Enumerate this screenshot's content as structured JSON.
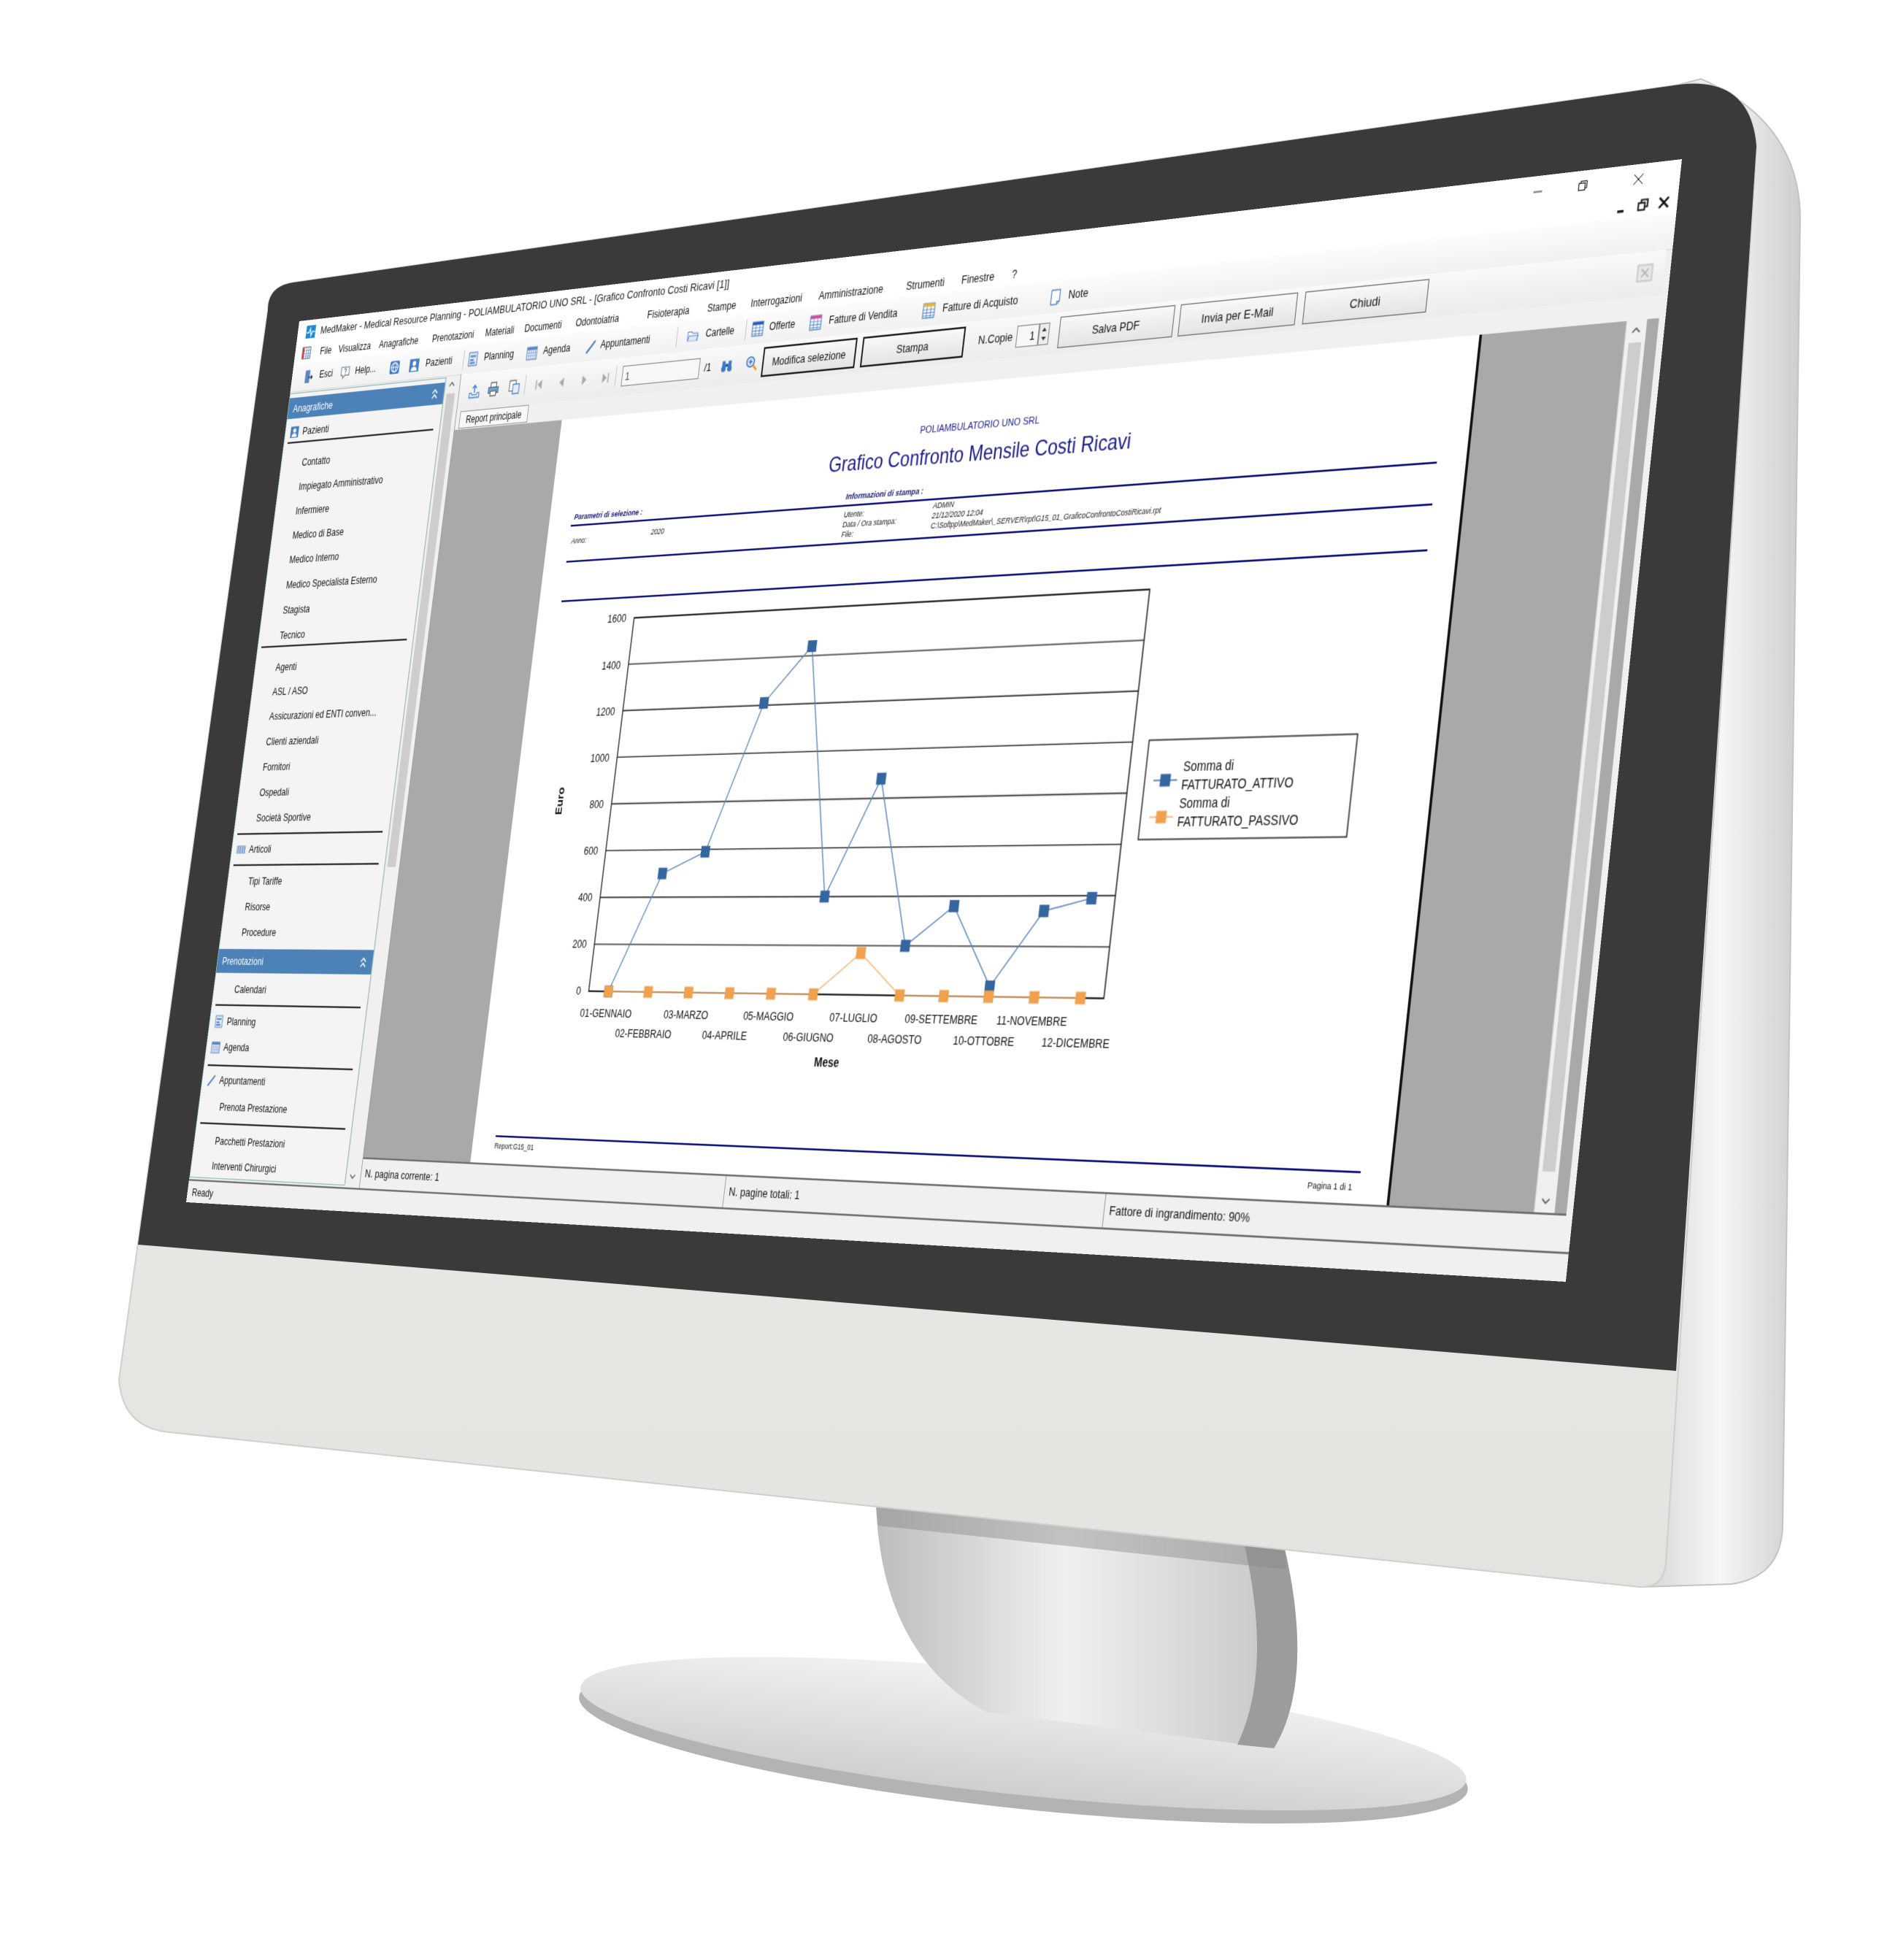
{
  "app": {
    "title": "MedMaker - Medical Resource Planning - POLIAMBULATORIO UNO SRL - [Grafico Confronto Costi Ricavi [1]]",
    "icon": "medmaker-logo-icon"
  },
  "menu": {
    "items": [
      "File",
      "Visualizza",
      "Anagrafiche",
      "Prenotazioni",
      "Materiali",
      "Documenti",
      "Odontoiatria",
      "Fisioterapia",
      "Stampe",
      "Interrogazioni",
      "Amministrazione",
      "Strumenti",
      "Finestre",
      "?"
    ]
  },
  "toolbar": {
    "items": [
      {
        "label": "Esci",
        "icon": "exit-icon"
      },
      {
        "label": "Help...",
        "icon": "help-icon"
      },
      {
        "label": "",
        "icon": "globe-icon"
      },
      {
        "label": "Pazienti",
        "icon": "patient-icon"
      },
      {
        "label": "Planning",
        "icon": "planning-icon"
      },
      {
        "label": "Agenda",
        "icon": "agenda-icon"
      },
      {
        "label": "Appuntamenti",
        "icon": "pencil-icon"
      },
      {
        "label": "Cartelle",
        "icon": "folder-icon"
      },
      {
        "label": "Offerte",
        "icon": "grid-blue-icon"
      },
      {
        "label": "Fatture di Vendita",
        "icon": "grid-pink-icon"
      },
      {
        "label": "Fatture di Acquisto",
        "icon": "grid-yellow-icon"
      },
      {
        "label": "Note",
        "icon": "note-icon"
      }
    ]
  },
  "sidebar": {
    "anagrafiche": {
      "header": "Anagrafiche",
      "items": [
        "Pazienti",
        "Contatto",
        "Impiegato Amministrativo",
        "Infermiere",
        "Medico di Base",
        "Medico Interno",
        "Medico Specialista Esterno",
        "Stagista",
        "Tecnico",
        "Agenti",
        "ASL / ASO",
        "Assicurazioni ed ENTI conven...",
        "Clienti aziendali",
        "Fornitori",
        "Ospedali",
        "Società Sportive",
        "Articoli",
        "Tipi Tariffe",
        "Risorse",
        "Procedure"
      ]
    },
    "prenotazioni": {
      "header": "Prenotazioni",
      "items": [
        "Calendari",
        "Planning",
        "Agenda",
        "Appuntamenti",
        "Prenota Prestazione",
        "Pacchetti Prestazioni",
        "Interventi Chirurgici"
      ]
    }
  },
  "report_toolbar": {
    "page_current": "1",
    "page_total": "/1",
    "modifica_selezione": "Modifica selezione",
    "stampa": "Stampa",
    "copies_label": "N.Copie",
    "copies_value": "1",
    "salva_pdf": "Salva PDF",
    "invia_email": "Invia per E-Mail",
    "chiudi": "Chiudi"
  },
  "tabs": {
    "report_principale": "Report principale"
  },
  "report": {
    "company": "POLIAMBULATORIO UNO SRL",
    "title": "Grafico Confronto Mensile Costi Ricavi",
    "params_header": "Parametri di selezione  :",
    "print_info_header": "Informazioni di stampa  :",
    "params": {
      "anno_label": "Anno:",
      "anno_value": "2020"
    },
    "print_info": {
      "utente_label": "Utente:",
      "utente_value": "ADMIN",
      "data_label": "Data / Ora stampa:",
      "data_value": "21/12/2020 12:04",
      "file_label": "File:",
      "file_value": "C:\\Softpp\\MedMaker\\_SERVER\\rpt\\G15_01_GraficoConfrontoCostiRicavi.rpt"
    },
    "footer": {
      "report_id": "Report:G15_01",
      "page": "Pagina 1 di 1"
    }
  },
  "chart_data": {
    "type": "line",
    "title": "",
    "xlabel": "Mese",
    "ylabel": "Euro",
    "categories": [
      "01-GENNAIO",
      "02-FEBBRAIO",
      "03-MARZO",
      "04-APRILE",
      "05-MAGGIO",
      "06-GIUGNO",
      "07-LUGLIO",
      "08-AGOSTO",
      "09-SETTEMBRE",
      "10-OTTOBRE",
      "11-NOVEMBRE",
      "12-DICEMBRE"
    ],
    "series": [
      {
        "name": "Somma di FATTURATO_ATTIVO",
        "legend_lines": [
          "Somma di",
          "FATTURATO_ATTIVO"
        ],
        "color": "#35669f",
        "line_color": "#5a87bd",
        "marker": "square",
        "values": [
          0,
          500,
          590,
          1210,
          1440,
          400,
          880,
          200,
          360,
          40,
          340,
          390
        ]
      },
      {
        "name": "Somma di FATTURATO_PASSIVO",
        "legend_lines": [
          "Somma di",
          "FATTURATO_PASSIVO"
        ],
        "color": "#f0a14f",
        "line_color": "#f6b878",
        "marker": "square",
        "values": [
          0,
          0,
          0,
          0,
          0,
          0,
          170,
          0,
          0,
          0,
          0,
          0
        ]
      }
    ],
    "ylim": [
      0,
      1600
    ],
    "yticks": [
      0,
      200,
      400,
      600,
      800,
      1000,
      1200,
      1400,
      1600
    ],
    "grid": true,
    "legend_position": "right"
  },
  "child_status": {
    "current_page": "N. pagina corrente: 1",
    "total_pages": "N. pagine totali: 1",
    "zoom": "Fattore di ingrandimento: 90%"
  },
  "status": {
    "text": "Ready"
  },
  "colors": {
    "accent": "#4d82b9",
    "report_navy": "#0a0a78",
    "series_attivo": "#35669f",
    "series_passivo": "#f0a14f",
    "bezel": "#3a3a3a"
  }
}
